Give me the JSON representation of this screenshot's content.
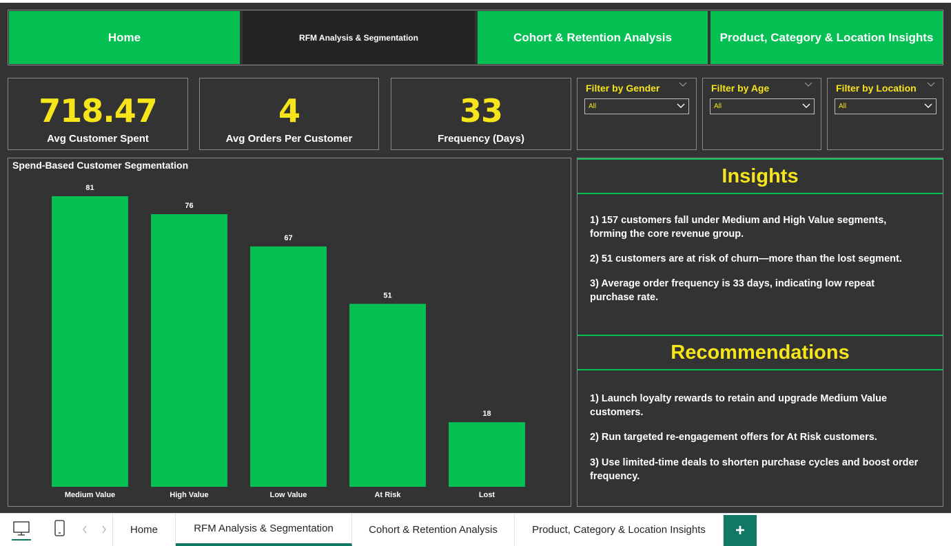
{
  "nav": {
    "home": "Home",
    "rfm": "RFM Analysis & Segmentation",
    "cohort": "Cohort & Retention Analysis",
    "product": "Product, Category & Location Insights"
  },
  "kpis": [
    {
      "value": "718.47",
      "label": "Avg Customer Spent"
    },
    {
      "value": "4",
      "label": "Avg Orders Per Customer"
    },
    {
      "value": "33",
      "label": "Frequency (Days)"
    }
  ],
  "filters": [
    {
      "title": "Filter by Gender",
      "value": "All"
    },
    {
      "title": "Filter by Age",
      "value": "All"
    },
    {
      "title": "Filter by Location",
      "value": "All"
    }
  ],
  "chart_data": {
    "type": "bar",
    "title": "Spend-Based Customer Segmentation",
    "categories": [
      "Medium Value",
      "High Value",
      "Low Value",
      "At Risk",
      "Lost"
    ],
    "values": [
      81,
      76,
      67,
      51,
      18
    ],
    "color": "#04bf52",
    "ylim": [
      0,
      81
    ],
    "grid": false
  },
  "insights": {
    "title": "Insights",
    "items": [
      "1) 157 customers fall under Medium and High Value segments, forming the core revenue group.",
      "2) 51 customers are at risk of churn—more than the lost segment.",
      "3) Average order frequency is 33 days, indicating low repeat purchase rate."
    ]
  },
  "recommendations": {
    "title": "Recommendations",
    "items": [
      "1) Launch loyalty rewards to retain and upgrade Medium Value customers.",
      "2) Run targeted re-engagement offers for At Risk customers.",
      "3) Use limited-time deals to shorten purchase cycles and boost order frequency."
    ]
  },
  "tabs": {
    "items": [
      "Home",
      "RFM Analysis & Segmentation",
      "Cohort & Retention Analysis",
      "Product, Category & Location Insights"
    ],
    "active": "RFM Analysis & Segmentation",
    "add": "+"
  },
  "colors": {
    "accent_green": "#04bf52",
    "kpi_yellow": "#f5e51a",
    "background": "#333333",
    "active_tab": "#252423",
    "tab_underline": "#117865"
  },
  "icons": {
    "desktop": "desktop-view-icon",
    "mobile": "mobile-view-icon",
    "prev": "chevron-left-icon",
    "next": "chevron-right-icon"
  }
}
